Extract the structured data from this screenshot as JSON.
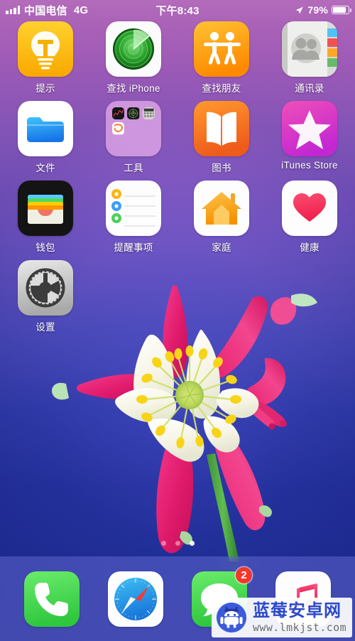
{
  "status_bar": {
    "carrier": "中国电信",
    "network": "4G",
    "time": "下午8:43",
    "battery_percent": "79%",
    "signal_icon": "signal-bars-icon",
    "location_icon": "location-arrow-icon",
    "battery_icon": "battery-icon"
  },
  "home_screen": {
    "rows": [
      [
        {
          "label": "提示",
          "icon": "tips-lightbulb-icon"
        },
        {
          "label": "查找 iPhone",
          "icon": "find-iphone-radar-icon"
        },
        {
          "label": "查找朋友",
          "icon": "find-friends-people-icon"
        },
        {
          "label": "通讯录",
          "icon": "contacts-book-icon"
        }
      ],
      [
        {
          "label": "文件",
          "icon": "files-folder-icon"
        },
        {
          "label": "工具",
          "icon": "tools-folder-icon",
          "is_folder": true,
          "folder_items": [
            "stocks-icon",
            "compass-icon",
            "calculator-icon",
            "sogou-input-icon"
          ]
        },
        {
          "label": "图书",
          "icon": "books-icon"
        },
        {
          "label": "iTunes Store",
          "icon": "itunes-store-star-icon"
        }
      ],
      [
        {
          "label": "钱包",
          "icon": "wallet-cards-icon"
        },
        {
          "label": "提醒事项",
          "icon": "reminders-list-icon"
        },
        {
          "label": "家庭",
          "icon": "home-house-icon"
        },
        {
          "label": "健康",
          "icon": "health-heart-icon"
        }
      ],
      [
        {
          "label": "设置",
          "icon": "settings-gear-icon"
        }
      ]
    ]
  },
  "page_indicator": {
    "total_pages": 3,
    "active_page": 3
  },
  "dock": {
    "items": [
      {
        "label": "电话",
        "icon": "phone-handset-icon",
        "badge": null
      },
      {
        "label": "Safari",
        "icon": "safari-compass-icon",
        "badge": null
      },
      {
        "label": "信息",
        "icon": "messages-bubble-icon",
        "badge": "2"
      },
      {
        "label": "音乐",
        "icon": "music-note-icon",
        "badge": null
      }
    ]
  },
  "watermark": {
    "site_name": "蓝莓安卓网",
    "url": "www.lmkjst.com",
    "logo_icon": "android-robot-logo-icon"
  },
  "colors": {
    "wallpaper_top": "#e987d4",
    "wallpaper_bottom": "#1f2e96",
    "badge_red": "#f6352b",
    "watermark_blue": "#2b49c9",
    "tips_yellow": "#ffc400",
    "find_friends_orange": "#ff9500",
    "books_orange": "#f26722",
    "itunes_magenta": "#e2329f",
    "phone_green": "#4cd964",
    "messages_green": "#4cd964"
  }
}
